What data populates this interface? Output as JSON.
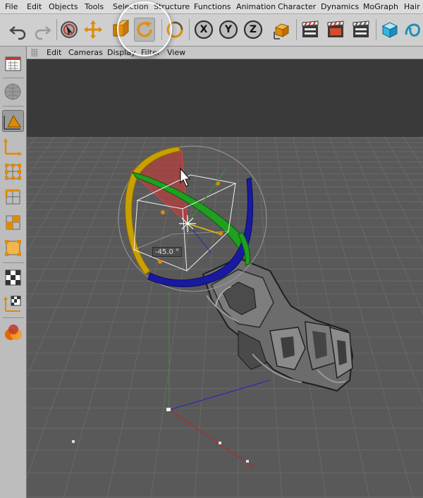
{
  "menu": [
    "File",
    "Edit",
    "Objects",
    "Tools",
    "Selection",
    "Structure",
    "Functions",
    "Animation",
    "Character",
    "Dynamics",
    "MoGraph",
    "Hair"
  ],
  "toolbar": {
    "icons": [
      "undo-icon",
      "redo-icon",
      "live-selection-icon",
      "move-icon",
      "scale-icon",
      "rotate-icon",
      "last-tool-icon",
      "x-axis-lock-icon",
      "y-axis-lock-icon",
      "z-axis-lock-icon",
      "world-coordinates-icon",
      "render-view-icon",
      "render-picture-viewer-icon",
      "render-settings-icon",
      "cube-primitive-icon",
      "spline-tool-icon"
    ],
    "axis_x": "X",
    "axis_y": "Y",
    "axis_z": "Z",
    "active_tool": "rotate"
  },
  "viewport": {
    "menu": [
      "Edit",
      "Cameras",
      "Display",
      "Filter",
      "View"
    ],
    "rotation_readout": "-45.0 °",
    "colors": {
      "background": "#3a3a3a",
      "floor": "#575757",
      "grid": "#6c6c6c",
      "axis_x": "#b02a2a",
      "axis_y": "#2aa02a",
      "axis_z": "#2a2ab0",
      "rot_band_x": "#c8a000",
      "rot_band_y": "#1fa01f",
      "rot_band_z": "#1a1aa0"
    }
  },
  "left_palette": {
    "icons": [
      "model-mode-icon",
      "texture-mode-icon",
      "object-mode-icon",
      "object-axis-icon",
      "points-mode-icon",
      "edges-mode-icon",
      "polygons-mode-icon",
      "uv-polygons-mode-icon",
      "texture-axis-icon",
      "workplane-icon",
      "paint-mode-icon"
    ]
  }
}
